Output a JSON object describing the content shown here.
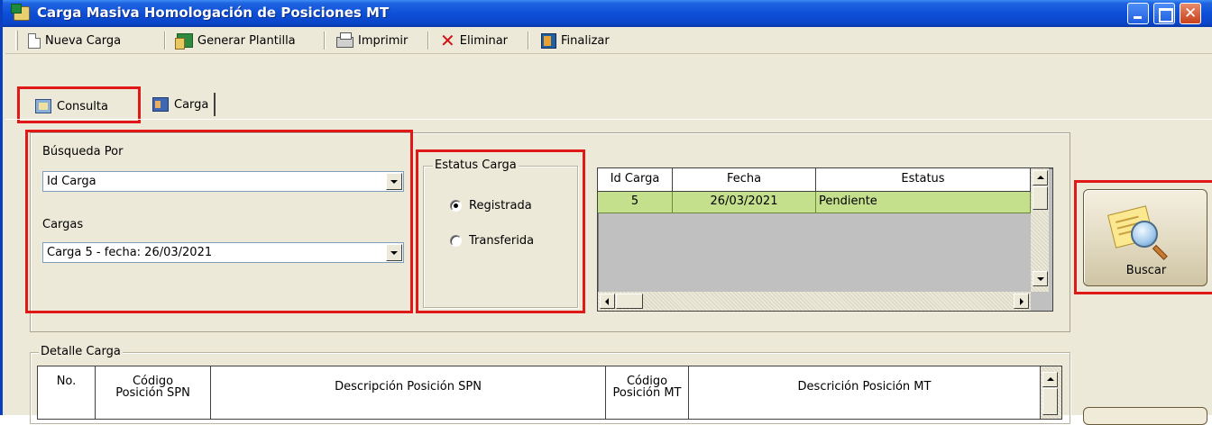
{
  "window": {
    "title": "Carga Masiva Homologación de Posiciones MT"
  },
  "toolbar": {
    "nueva_carga": "Nueva Carga",
    "generar_plantilla": "Generar Plantilla",
    "imprimir": "Imprimir",
    "eliminar": "Eliminar",
    "finalizar": "Finalizar"
  },
  "tabs": {
    "consulta": "Consulta",
    "carga": "Carga"
  },
  "search": {
    "busqueda_label": "Búsqueda Por",
    "busqueda_value": "Id Carga",
    "cargas_label": "Cargas",
    "cargas_value": "Carga 5 - fecha: 26/03/2021"
  },
  "estatus": {
    "legend": "Estatus Carga",
    "options": [
      "Registrada",
      "Transferida"
    ],
    "selected": "Registrada"
  },
  "results_grid": {
    "columns": [
      "Id Carga",
      "Fecha",
      "Estatus"
    ],
    "rows": [
      [
        "5",
        "26/03/2021",
        "Pendiente"
      ]
    ]
  },
  "buscar": {
    "label": "Buscar"
  },
  "detalle": {
    "legend": "Detalle Carga",
    "columns": [
      "No.",
      "Código\nPosición SPN",
      "Descripción Posición SPN",
      "Código\nPosición MT",
      "Descrición Posición MT"
    ]
  },
  "colors": {
    "title_bar": "#0a45c8",
    "highlight_box": "#e01818",
    "selected_row": "#c4e08c"
  }
}
